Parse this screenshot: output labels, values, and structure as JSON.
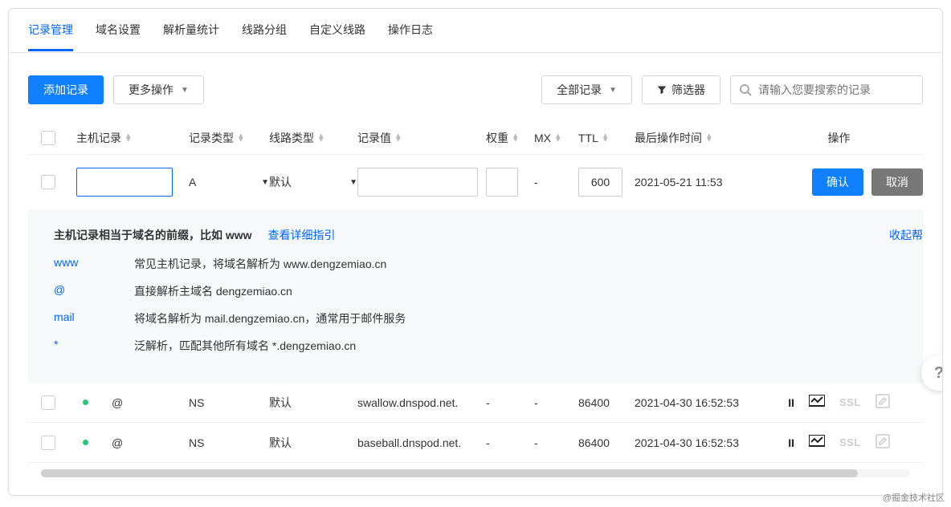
{
  "tabs": [
    "记录管理",
    "域名设置",
    "解析量统计",
    "线路分组",
    "自定义线路",
    "操作日志"
  ],
  "toolbar": {
    "add_record": "添加记录",
    "more_actions": "更多操作",
    "all_records": "全部记录",
    "filter": "筛选器",
    "search_placeholder": "请输入您要搜索的记录"
  },
  "columns": {
    "host": "主机记录",
    "type": "记录类型",
    "line": "线路类型",
    "value": "记录值",
    "weight": "权重",
    "mx": "MX",
    "ttl": "TTL",
    "time": "最后操作时间",
    "actions": "操作"
  },
  "edit_row": {
    "type": "A",
    "line": "默认",
    "mx_display": "-",
    "ttl": "600",
    "time": "2021-05-21 11:53",
    "confirm": "确认",
    "cancel": "取消"
  },
  "help": {
    "title": "主机记录相当于域名的前缀，比如 www",
    "guide_link": "查看详细指引",
    "collapse": "收起帮",
    "items": [
      {
        "key": "www",
        "desc": "常见主机记录，将域名解析为 www.dengzemiao.cn"
      },
      {
        "key": "@",
        "desc": "直接解析主域名 dengzemiao.cn"
      },
      {
        "key": "mail",
        "desc": "将域名解析为 mail.dengzemiao.cn，通常用于邮件服务"
      },
      {
        "key": "*",
        "desc": "泛解析，匹配其他所有域名 *.dengzemiao.cn"
      }
    ]
  },
  "records": [
    {
      "host": "@",
      "type": "NS",
      "line": "默认",
      "value": "swallow.dnspod.net.",
      "weight": "-",
      "mx": "-",
      "ttl": "86400",
      "time": "2021-04-30 16:52:53"
    },
    {
      "host": "@",
      "type": "NS",
      "line": "默认",
      "value": "baseball.dnspod.net.",
      "weight": "-",
      "mx": "-",
      "ttl": "86400",
      "time": "2021-04-30 16:52:53"
    }
  ],
  "ssl_label": "SSL",
  "watermark": "@掘金技术社区"
}
